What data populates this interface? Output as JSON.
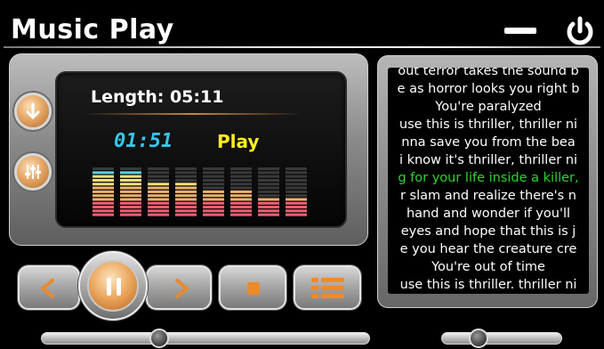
{
  "window": {
    "title": "Music Play"
  },
  "track": {
    "length_label": "Length: 05:11",
    "elapsed": "01:51",
    "state": "Play",
    "progress": 0.36
  },
  "volume": {
    "level": 0.31
  },
  "lyrics": {
    "lines": [
      "out terror takes the sound b",
      "e as horror looks you right b",
      "You're paralyzed",
      "use this is thriller, thriller ni",
      "nna save you from the bea",
      "i know it's thriller, thriller ni",
      "g for your life inside a killer,",
      "r slam and realize there's n",
      "hand and wonder if you'll",
      "eyes and hope that this is j",
      "e you hear the creature cre",
      "You're out of time",
      "use this is thriller. thriller ni"
    ],
    "active_index": 6
  },
  "equalizer": {
    "levels": [
      0.9,
      0.9,
      0.72,
      0.72,
      0.55,
      0.55,
      0.38,
      0.38
    ]
  },
  "colors": {
    "time": "#35c6ee",
    "state": "#ffee22",
    "active_lyric": "#2fd42f",
    "accent": "#e6a868"
  },
  "icons": {
    "minimize": "minimize-icon",
    "power": "power-icon",
    "download": "down-arrow-icon",
    "eq": "equalizer-sliders-icon",
    "prev": "chevron-left-icon",
    "pause": "pause-icon",
    "next": "chevron-right-icon",
    "stop": "stop-icon",
    "playlist": "list-icon"
  }
}
